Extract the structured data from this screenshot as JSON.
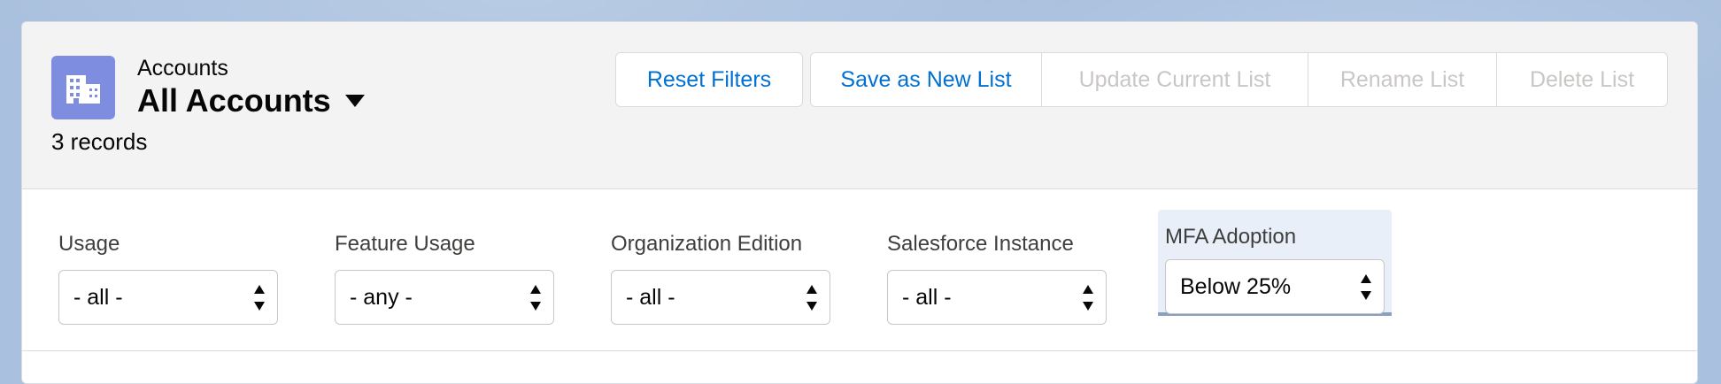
{
  "header": {
    "object_label": "Accounts",
    "list_title": "All Accounts",
    "record_count": "3 records",
    "icon": "building-icon",
    "icon_color": "#7f8de1"
  },
  "toolbar": {
    "reset_filters": "Reset Filters",
    "save_as_new_list": "Save as New List",
    "update_current_list": "Update Current List",
    "rename_list": "Rename List",
    "delete_list": "Delete List"
  },
  "filters": [
    {
      "label": "Usage",
      "value": "- all -"
    },
    {
      "label": "Feature Usage",
      "value": "- any -"
    },
    {
      "label": "Organization Edition",
      "value": "- all -"
    },
    {
      "label": "Salesforce Instance",
      "value": "- all -"
    },
    {
      "label": "MFA Adoption",
      "value": "Below 25%"
    }
  ],
  "colors": {
    "link_blue": "#0070d2",
    "disabled_text": "#c9c7c5",
    "highlight_panel": "#e8eff9"
  }
}
